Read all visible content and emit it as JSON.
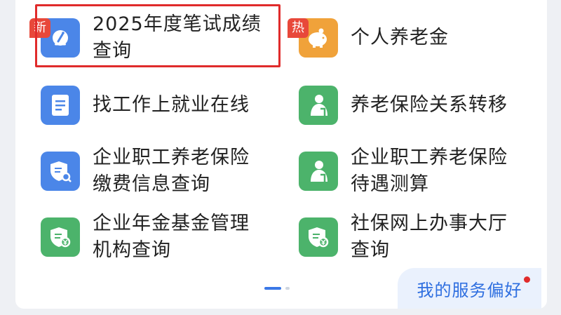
{
  "colors": {
    "blue": "#4b86e8",
    "orange": "#f0a23a",
    "green": "#4cb36b",
    "badge_new": "#e8483a",
    "badge_hot": "#e8483a",
    "highlight": "#e02b2b"
  },
  "services": [
    {
      "label_line1": "2025年度笔试成绩",
      "label_line2": "查询",
      "badge": "新",
      "icon": "edit-search-icon",
      "icon_color": "blue"
    },
    {
      "label_line1": "个人养老金",
      "label_line2": "",
      "badge": "热",
      "icon": "piggy-bank-icon",
      "icon_color": "orange"
    },
    {
      "label_line1": "找工作上就业在线",
      "label_line2": "",
      "badge": "",
      "icon": "document-icon",
      "icon_color": "blue"
    },
    {
      "label_line1": "养老保险关系转移",
      "label_line2": "",
      "badge": "",
      "icon": "elder-person-icon",
      "icon_color": "green"
    },
    {
      "label_line1": "企业职工养老保险",
      "label_line2": "缴费信息查询",
      "badge": "",
      "icon": "shield-search-icon",
      "icon_color": "blue"
    },
    {
      "label_line1": "企业职工养老保险",
      "label_line2": "待遇测算",
      "badge": "",
      "icon": "elder-person-icon",
      "icon_color": "green"
    },
    {
      "label_line1": "企业年金基金管理",
      "label_line2": "机构查询",
      "badge": "",
      "icon": "shield-yen-icon",
      "icon_color": "green"
    },
    {
      "label_line1": "社保网上办事大厅",
      "label_line2": "查询",
      "badge": "",
      "icon": "shield-yen-icon",
      "icon_color": "green"
    }
  ],
  "preferences_button": "我的服务偏好"
}
